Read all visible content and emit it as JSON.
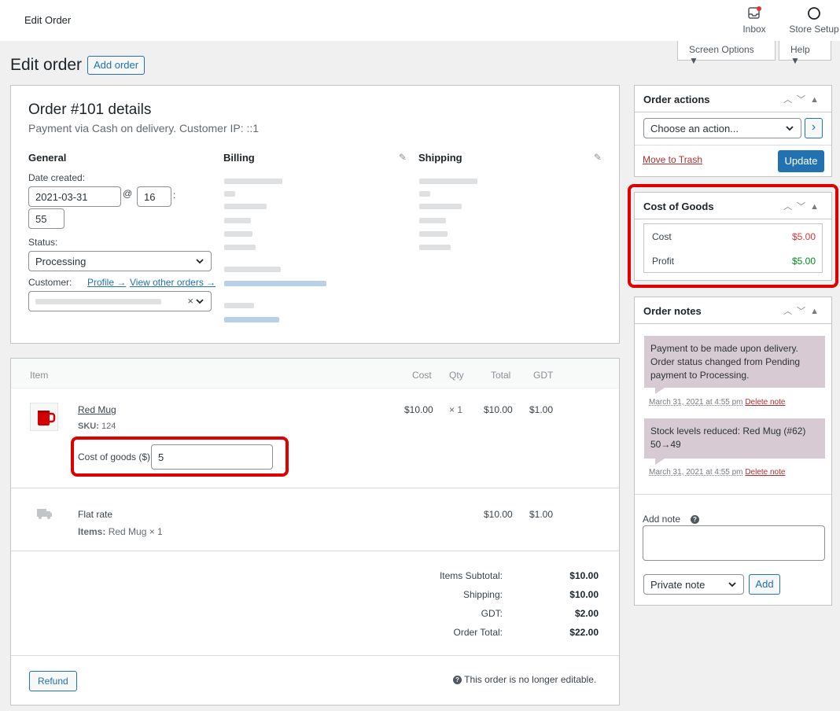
{
  "topbar": {
    "title": "Edit Order",
    "inbox_label": "Inbox",
    "setup_label": "Store Setup"
  },
  "screen_options": {
    "label": "Screen Options ▼",
    "help": "Help ▼"
  },
  "page": {
    "title": "Edit order",
    "add_order": "Add order"
  },
  "details": {
    "heading": "Order #101 details",
    "subheading": "Payment via Cash on delivery. Customer IP: ::1",
    "general": {
      "heading": "General",
      "date_label": "Date created:",
      "date_value": "2021-03-31",
      "at": "@",
      "hour": "16",
      "colon": ":",
      "minute": "55",
      "status_label": "Status:",
      "status_value": "Processing",
      "customer_label": "Customer:",
      "profile_link": "Profile →",
      "other_orders_link": "View other orders →",
      "clear": "×"
    },
    "billing_heading": "Billing",
    "shipping_heading": "Shipping"
  },
  "items": {
    "headers": {
      "item": "Item",
      "cost": "Cost",
      "qty": "Qty",
      "total": "Total",
      "gdt": "GDT"
    },
    "product": {
      "name": "Red Mug",
      "sku_label": "SKU:",
      "sku": "124",
      "cost": "$10.00",
      "qty": "× 1",
      "total": "$10.00",
      "gdt": "$1.00",
      "cog_label": "Cost of goods ($)",
      "cog_value": "5"
    },
    "shipping": {
      "name": "Flat rate",
      "items_label": "Items:",
      "items_value": "Red Mug × 1",
      "total": "$10.00",
      "gdt": "$1.00"
    },
    "totals": [
      {
        "label": "Items Subtotal:",
        "value": "$10.00"
      },
      {
        "label": "Shipping:",
        "value": "$10.00"
      },
      {
        "label": "GDT:",
        "value": "$2.00"
      },
      {
        "label": "Order Total:",
        "value": "$22.00"
      }
    ],
    "refund": "Refund",
    "not_editable": "This order is no longer editable."
  },
  "order_actions": {
    "title": "Order actions",
    "select_value": "Choose an action...",
    "go": "›",
    "trash": "Move to Trash",
    "update": "Update"
  },
  "cost_of_goods": {
    "title": "Cost of Goods",
    "cost_label": "Cost",
    "cost_value": "$5.00",
    "profit_label": "Profit",
    "profit_value": "$5.00"
  },
  "order_notes": {
    "title": "Order notes",
    "notes": [
      {
        "text": "Payment to be made upon delivery. Order status changed from Pending payment to Processing.",
        "date": "March 31, 2021 at 4:55 pm",
        "delete": "Delete note"
      },
      {
        "text": "Stock levels reduced: Red Mug (#62) 50→49",
        "date": "March 31, 2021 at 4:55 pm",
        "delete": "Delete note"
      }
    ],
    "add_label": "Add note",
    "help": "?",
    "type_value": "Private note",
    "add_button": "Add"
  },
  "colors": {
    "accent": "#2271b1",
    "highlight": "#e00000",
    "cost_red": "#d63638",
    "profit_green": "#00a32a",
    "note_bg": "#d7cad2"
  }
}
